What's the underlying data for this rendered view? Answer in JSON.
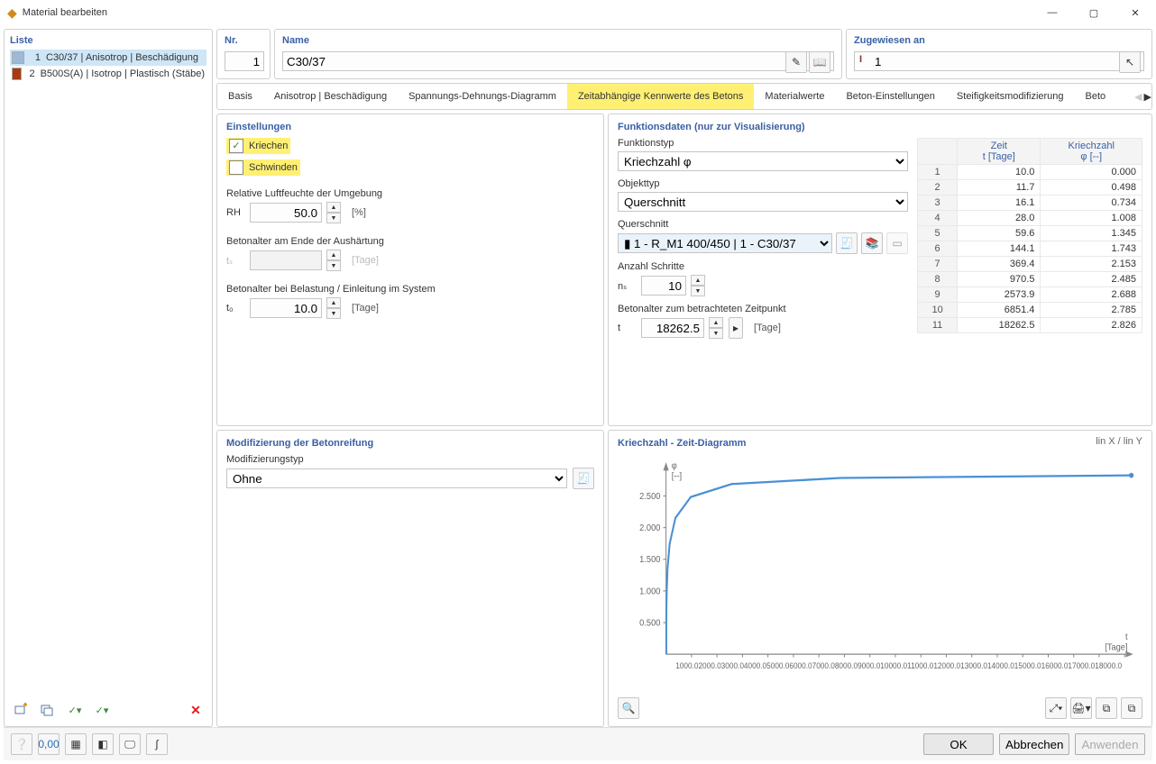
{
  "window": {
    "title": "Material bearbeiten"
  },
  "left": {
    "heading": "Liste",
    "items": [
      {
        "num": "1",
        "text": "C30/37 | Anisotrop | Beschädigung",
        "color": "#9db9d6"
      },
      {
        "num": "2",
        "text": "B500S(A) | Isotrop | Plastisch (Stäbe)",
        "color": "#a83a12"
      }
    ],
    "selected_index": 0
  },
  "header": {
    "nr_label": "Nr.",
    "nr_value": "1",
    "name_label": "Name",
    "name_value": "C30/37",
    "assigned_label": "Zugewiesen an",
    "assigned_value": "1"
  },
  "tabs": [
    "Basis",
    "Anisotrop | Beschädigung",
    "Spannungs-Dehnungs-Diagramm",
    "Zeitabhängige Kennwerte des Betons",
    "Materialwerte",
    "Beton-Einstellungen",
    "Steifigkeitsmodifizierung",
    "Beto"
  ],
  "active_tab_index": 3,
  "settings": {
    "title": "Einstellungen",
    "creep_label": "Kriechen",
    "shrink_label": "Schwinden",
    "rh_title": "Relative Luftfeuchte der Umgebung",
    "rh_symbol": "RH",
    "rh_value": "50.0",
    "rh_unit": "[%]",
    "ts_title": "Betonalter am Ende der Aushärtung",
    "ts_symbol": "tₛ",
    "ts_value": "",
    "ts_unit": "[Tage]",
    "t0_title": "Betonalter bei Belastung / Einleitung im System",
    "t0_symbol": "t₀",
    "t0_value": "10.0",
    "t0_unit": "[Tage]"
  },
  "func": {
    "title": "Funktionsdaten (nur zur Visualisierung)",
    "ftype_label": "Funktionstyp",
    "ftype_value": "Kriechzahl φ",
    "otype_label": "Objekttyp",
    "otype_value": "Querschnitt",
    "cs_label": "Querschnitt",
    "cs_value": "1 - R_M1 400/450 | 1 - C30/37",
    "steps_label": "Anzahl Schritte",
    "steps_symbol": "nₛ",
    "steps_value": "10",
    "t_label": "Betonalter zum betrachteten Zeitpunkt",
    "t_symbol": "t",
    "t_value": "18262.5",
    "t_unit": "[Tage]"
  },
  "table": {
    "col_time": "Zeit",
    "col_time_unit": "t [Tage]",
    "col_creep": "Kriechzahl",
    "col_creep_unit": "φ [--]",
    "rows": [
      {
        "t": "10.0",
        "phi": "0.000"
      },
      {
        "t": "11.7",
        "phi": "0.498"
      },
      {
        "t": "16.1",
        "phi": "0.734"
      },
      {
        "t": "28.0",
        "phi": "1.008"
      },
      {
        "t": "59.6",
        "phi": "1.345"
      },
      {
        "t": "144.1",
        "phi": "1.743"
      },
      {
        "t": "369.4",
        "phi": "2.153"
      },
      {
        "t": "970.5",
        "phi": "2.485"
      },
      {
        "t": "2573.9",
        "phi": "2.688"
      },
      {
        "t": "6851.4",
        "phi": "2.785"
      },
      {
        "t": "18262.5",
        "phi": "2.826"
      }
    ]
  },
  "mod": {
    "title": "Modifizierung der Betonreifung",
    "type_label": "Modifizierungstyp",
    "type_value": "Ohne"
  },
  "chart": {
    "title": "Kriechzahl - Zeit-Diagramm",
    "axis_toggle": "lin X / lin Y",
    "y_label": "φ",
    "y_unit": "[--]",
    "x_label": "t",
    "x_unit": "[Tage]",
    "y_ticks": [
      "0.500",
      "1.000",
      "1.500",
      "2.000",
      "2.500"
    ],
    "x_ticks": [
      "1000.0",
      "2000.0",
      "3000.0",
      "4000.0",
      "5000.0",
      "6000.0",
      "7000.0",
      "8000.0",
      "9000.0",
      "10000.0",
      "11000.0",
      "12000.0",
      "13000.0",
      "14000.0",
      "15000.0",
      "16000.0",
      "17000.0",
      "18000.0"
    ]
  },
  "chart_data": {
    "type": "line",
    "title": "Kriechzahl - Zeit-Diagramm",
    "xlabel": "t [Tage]",
    "ylabel": "φ [--]",
    "xlim": [
      0,
      18262.5
    ],
    "ylim": [
      0,
      3.0
    ],
    "series": [
      {
        "name": "Kriechzahl φ",
        "x": [
          10.0,
          11.7,
          16.1,
          28.0,
          59.6,
          144.1,
          369.4,
          970.5,
          2573.9,
          6851.4,
          18262.5
        ],
        "y": [
          0.0,
          0.498,
          0.734,
          1.008,
          1.345,
          1.743,
          2.153,
          2.485,
          2.688,
          2.785,
          2.826
        ]
      }
    ]
  },
  "buttons": {
    "ok": "OK",
    "cancel": "Abbrechen",
    "apply": "Anwenden"
  }
}
